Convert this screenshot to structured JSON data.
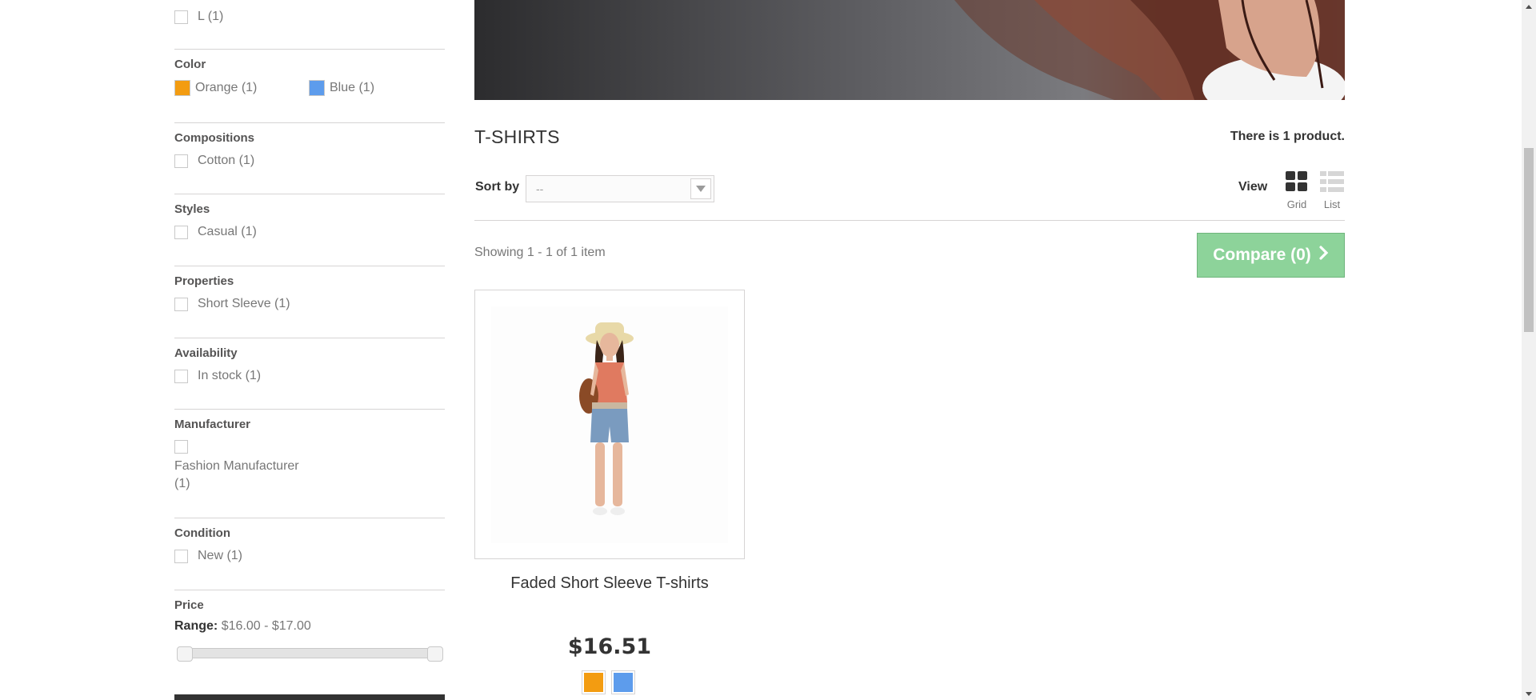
{
  "sidebar": {
    "size_item": {
      "label": "L (1)"
    },
    "color": {
      "title": "Color",
      "items": [
        {
          "label": "Orange (1)",
          "swatch": "#F39C11"
        },
        {
          "label": "Blue (1)",
          "swatch": "#5D9CEC"
        }
      ]
    },
    "compositions": {
      "title": "Compositions",
      "items": [
        {
          "label": "Cotton (1)"
        }
      ]
    },
    "styles": {
      "title": "Styles",
      "items": [
        {
          "label": "Casual (1)"
        }
      ]
    },
    "properties": {
      "title": "Properties",
      "items": [
        {
          "label": "Short Sleeve (1)"
        }
      ]
    },
    "availability": {
      "title": "Availability",
      "items": [
        {
          "label": "In stock (1)"
        }
      ]
    },
    "manufacturer": {
      "title": "Manufacturer",
      "items": [
        {
          "label": "Fashion Manufacturer (1)"
        }
      ]
    },
    "condition": {
      "title": "Condition",
      "items": [
        {
          "label": "New (1)"
        }
      ]
    },
    "price": {
      "title": "Price",
      "range_label": "Range:",
      "range_value": "$16.00 - $17.00",
      "range_min": 16.0,
      "range_max": 17.0
    }
  },
  "main": {
    "category_title": "T-SHIRTS",
    "product_count": "There is 1 product.",
    "sort": {
      "label": "Sort by",
      "selected": "--"
    },
    "view": {
      "label": "View",
      "grid_label": "Grid",
      "list_label": "List",
      "active": "grid"
    },
    "showing": "Showing 1 - 1 of 1 item",
    "compare_label": "Compare (0)",
    "products": [
      {
        "name": "Faded Short Sleeve T-shirts",
        "price": "$16.51",
        "colors": [
          "#F39C11",
          "#5D9CEC"
        ]
      }
    ]
  },
  "colors": {
    "compare_button": "#8DD39A",
    "border": "#D6D4D4"
  }
}
